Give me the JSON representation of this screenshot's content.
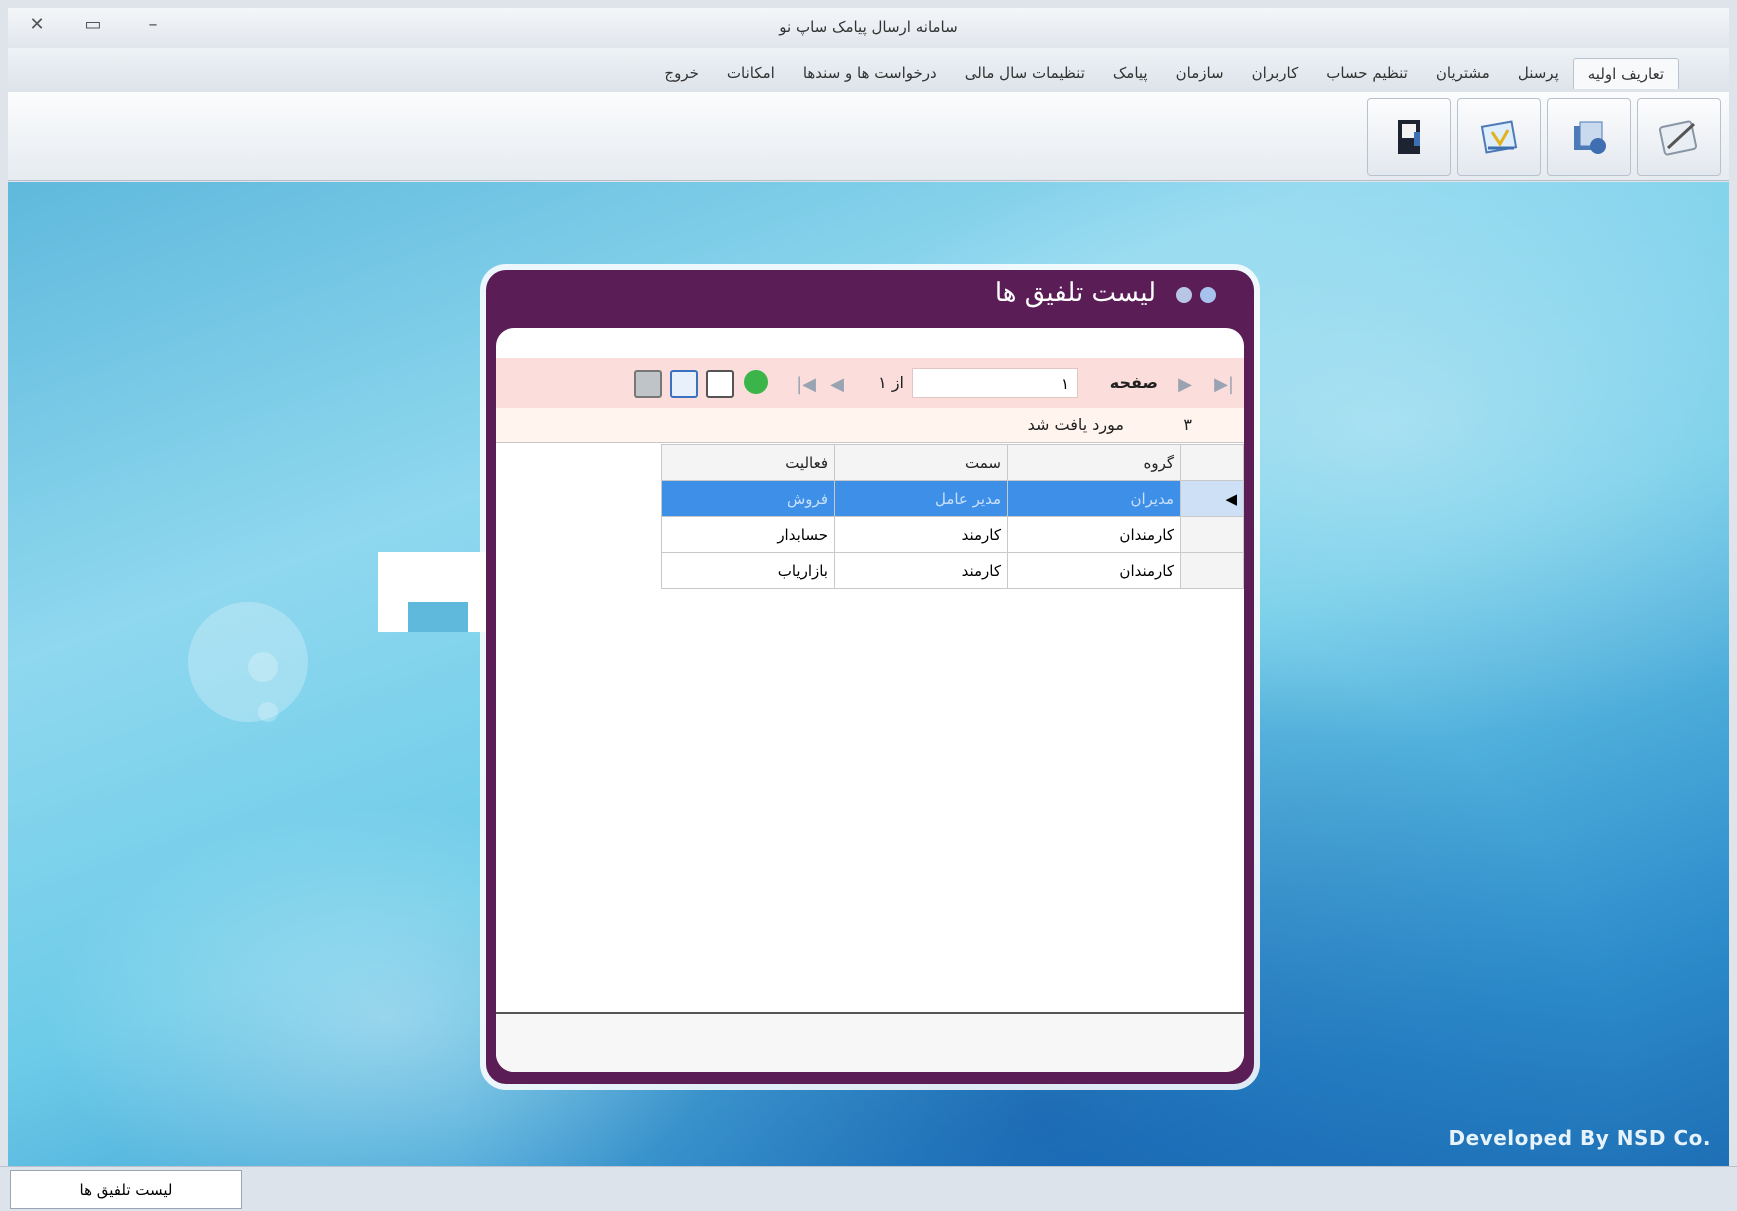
{
  "window": {
    "title": "سامانه ارسال پیامک ساپ نو",
    "close": "✕",
    "maximize": "▭",
    "minimize": "–"
  },
  "menu": {
    "tabs": [
      {
        "label": "تعاریف اولیه",
        "active": true
      },
      {
        "label": "پرسنل"
      },
      {
        "label": "مشتریان"
      },
      {
        "label": "تنظیم حساب"
      },
      {
        "label": "کاربران"
      },
      {
        "label": "سازمان"
      },
      {
        "label": "پیامک"
      },
      {
        "label": "تنظیمات سال مالی"
      },
      {
        "label": "درخواست ها و سندها"
      },
      {
        "label": "امکانات"
      },
      {
        "label": "خروج"
      }
    ]
  },
  "ribbon": {
    "icons": [
      "notepad-icon",
      "folder-icon",
      "document-icon",
      "book-icon"
    ]
  },
  "desktop": {
    "developed_by": "Developed By NSD Co."
  },
  "dialog": {
    "title": "لیست تلفیق ها",
    "navigator": {
      "page_label": "صفحه",
      "page_value": "۱",
      "of_label": "از ۱"
    },
    "count_number": "۳",
    "count_label": "مورد یافت شد",
    "grid": {
      "headers": {
        "group": "گروه",
        "position": "سمت",
        "activity": "فعالیت"
      },
      "rows": [
        {
          "group": "مدیران",
          "position": "مدیر عامل",
          "activity": "فروش",
          "selected": true
        },
        {
          "group": "کارمندان",
          "position": "کارمند",
          "activity": "حسابدار"
        },
        {
          "group": "کارمندان",
          "position": "کارمند",
          "activity": "بازاریاب"
        }
      ]
    }
  },
  "taskbar": {
    "item": "لیست تلفیق ها"
  },
  "colors": {
    "dialog_frame": "#5a1d56",
    "selected_row": "#3d8fe8",
    "navbar": "#fbdedb"
  }
}
